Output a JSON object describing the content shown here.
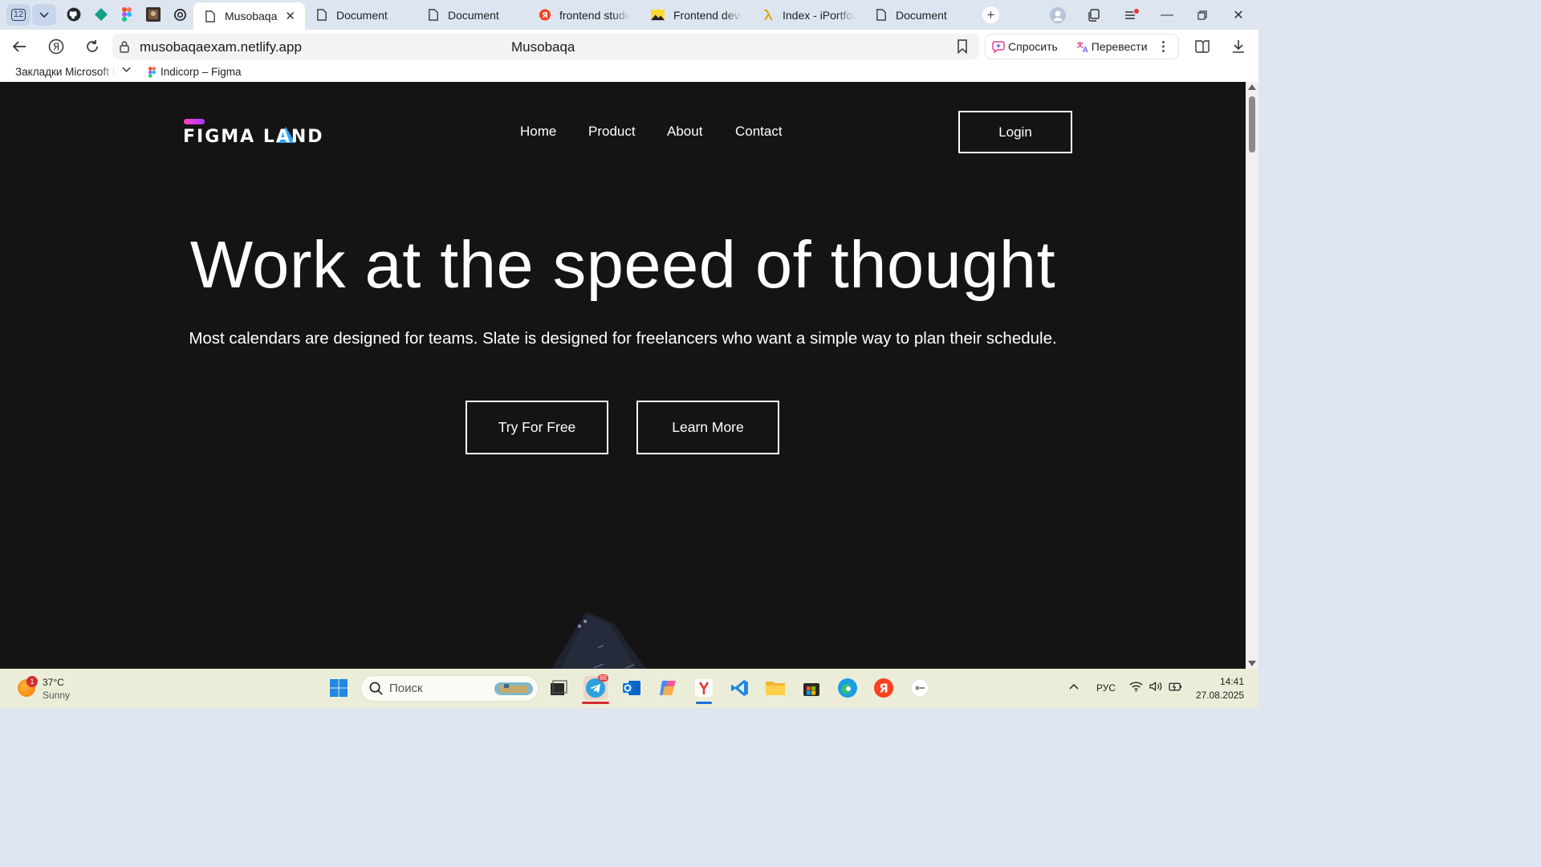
{
  "browser": {
    "tab_count": "12",
    "tabs": [
      {
        "title": "Musobaqa",
        "active": true
      },
      {
        "title": "Document"
      },
      {
        "title": "Document"
      },
      {
        "title": "frontend studer"
      },
      {
        "title": "Frontend develo"
      },
      {
        "title": "Index - iPortfolio"
      },
      {
        "title": "Document"
      }
    ],
    "address": {
      "url": "musobaqaexam.netlify.app",
      "page_title": "Musobaqa"
    },
    "ai_actions": {
      "ask": "Спросить",
      "translate": "Перевести"
    },
    "bookmarks": {
      "folder": "Закладки Microsoft Edge",
      "figma": "Indicorp – Figma"
    }
  },
  "site": {
    "logo": "FIGMA LAND",
    "nav": [
      "Home",
      "Product",
      "About",
      "Contact"
    ],
    "login": "Login",
    "hero_title": "Work at the speed of thought",
    "hero_subtitle": "Most calendars are designed for teams. Slate is designed for freelancers who want a simple way to plan their schedule.",
    "cta_primary": "Try For Free",
    "cta_secondary": "Learn More",
    "colors": {
      "background": "#141414",
      "logo_bar": "#ff3fbf",
      "logo_triangle": "#2fa3ff"
    }
  },
  "taskbar": {
    "weather": {
      "temp": "37°C",
      "condition": "Sunny",
      "alerts": "1"
    },
    "search_placeholder": "Поиск",
    "telegram_badge": "88",
    "language": "РУС",
    "time": "14:41",
    "date": "27.08.2025"
  }
}
